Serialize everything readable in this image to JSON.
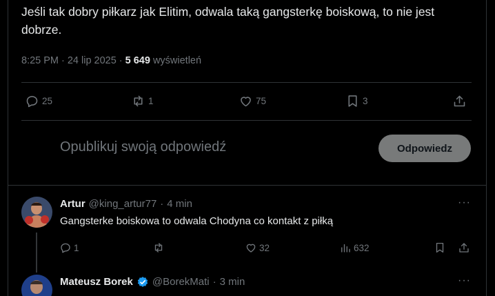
{
  "tweet": {
    "text": "Jeśli tak dobry piłkarz jak Elitim, odwala taką gangsterkę boiskową, to nie jest dobrze.",
    "time": "8:25 PM",
    "date": "24 lip 2025",
    "views_count": "5 649",
    "views_label": "wyświetleń",
    "separator": "·",
    "actions": {
      "replies": "25",
      "reposts": "1",
      "likes": "75",
      "bookmarks": "3"
    }
  },
  "compose": {
    "placeholder": "Opublikuj swoją odpowiedź",
    "button_label": "Odpowiedz"
  },
  "replies": [
    {
      "name": "Artur",
      "handle": "@king_artur77",
      "time": "4 min",
      "text": "Gangsterke boiskowa to odwala Chodyna co kontakt z piłką",
      "actions": {
        "replies": "1",
        "reposts": "",
        "likes": "32",
        "views": "632"
      },
      "more": "···"
    },
    {
      "name": "Mateusz Borek",
      "handle": "@BorekMati",
      "time": "3 min",
      "verified": true,
      "more": "···"
    }
  ],
  "colors": {
    "background": "#000000",
    "text": "#e7e9ea",
    "muted": "#71767b",
    "border": "#2f3336",
    "verified": "#1d9bf0"
  }
}
